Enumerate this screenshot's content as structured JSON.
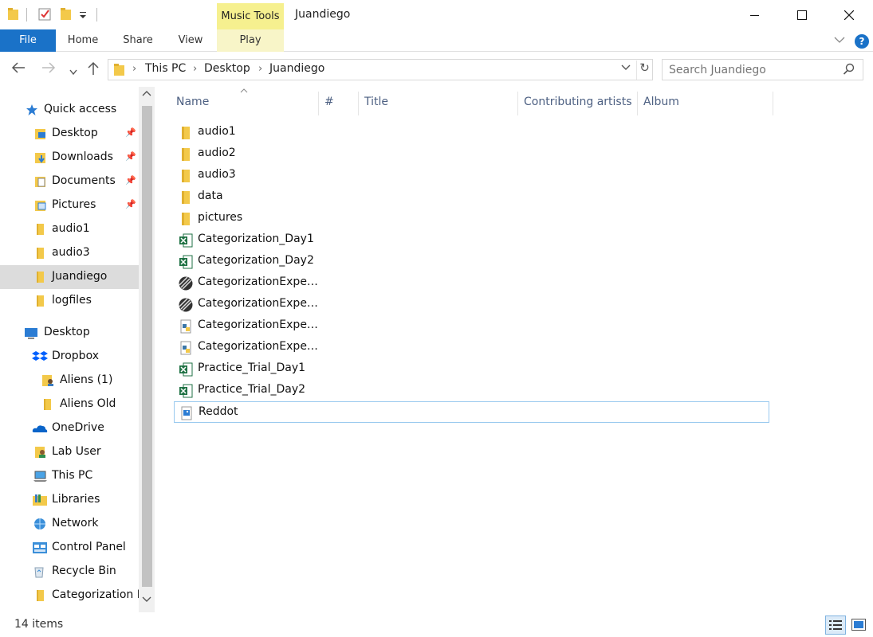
{
  "window": {
    "title": "Juandiego",
    "context_tab_label": "Music Tools"
  },
  "ribbon": {
    "tabs": [
      "File",
      "Home",
      "Share",
      "View",
      "Play"
    ]
  },
  "address": {
    "crumbs": [
      "This PC",
      "Desktop",
      "Juandiego"
    ]
  },
  "search": {
    "placeholder": "Search Juandiego"
  },
  "nav": {
    "items": [
      {
        "label": "Quick access",
        "icon": "star-icon"
      },
      {
        "label": "Desktop",
        "icon": "folder-desktop-icon",
        "pinned": true
      },
      {
        "label": "Downloads",
        "icon": "folder-downloads-icon",
        "pinned": true
      },
      {
        "label": "Documents",
        "icon": "folder-documents-icon",
        "pinned": true
      },
      {
        "label": "Pictures",
        "icon": "folder-pictures-icon",
        "pinned": true
      },
      {
        "label": "audio1",
        "icon": "folder-icon"
      },
      {
        "label": "audio3",
        "icon": "folder-icon"
      },
      {
        "label": "Juandiego",
        "icon": "folder-icon",
        "selected": true
      },
      {
        "label": "logfiles",
        "icon": "folder-icon"
      },
      {
        "label": "Desktop",
        "icon": "desktop-icon"
      },
      {
        "label": "Dropbox",
        "icon": "dropbox-icon"
      },
      {
        "label": "Aliens (1)",
        "icon": "shared-folder-icon"
      },
      {
        "label": "Aliens Old",
        "icon": "folder-icon"
      },
      {
        "label": "OneDrive",
        "icon": "onedrive-icon"
      },
      {
        "label": "Lab User",
        "icon": "user-folder-icon"
      },
      {
        "label": "This PC",
        "icon": "this-pc-icon"
      },
      {
        "label": "Libraries",
        "icon": "libraries-icon"
      },
      {
        "label": "Network",
        "icon": "network-icon"
      },
      {
        "label": "Control Panel",
        "icon": "control-panel-icon"
      },
      {
        "label": "Recycle Bin",
        "icon": "recycle-bin-icon"
      },
      {
        "label": "Categorization E",
        "icon": "folder-icon"
      }
    ]
  },
  "columns": [
    "Name",
    "#",
    "Title",
    "Contributing artists",
    "Album"
  ],
  "files": [
    {
      "name": "audio1",
      "type": "folder"
    },
    {
      "name": "audio2",
      "type": "folder"
    },
    {
      "name": "audio3",
      "type": "folder"
    },
    {
      "name": "data",
      "type": "folder"
    },
    {
      "name": "pictures",
      "type": "folder"
    },
    {
      "name": "Categorization_Day1",
      "type": "excel"
    },
    {
      "name": "Categorization_Day2",
      "type": "excel"
    },
    {
      "name": "CategorizationExpe…",
      "type": "psychopy"
    },
    {
      "name": "CategorizationExpe…",
      "type": "psychopy"
    },
    {
      "name": "CategorizationExpe…",
      "type": "python"
    },
    {
      "name": "CategorizationExpe…",
      "type": "python"
    },
    {
      "name": "Practice_Trial_Day1",
      "type": "excel"
    },
    {
      "name": "Practice_Trial_Day2",
      "type": "excel"
    },
    {
      "name": "Reddot",
      "type": "image",
      "focused": true
    }
  ],
  "status": {
    "item_count": "14 items"
  },
  "colors": {
    "accent": "#1a72c8",
    "folder": "#f3c94a",
    "excel": "#1f7244",
    "context_tab": "#f6f08f",
    "selected_nav": "#dcdcdc"
  }
}
